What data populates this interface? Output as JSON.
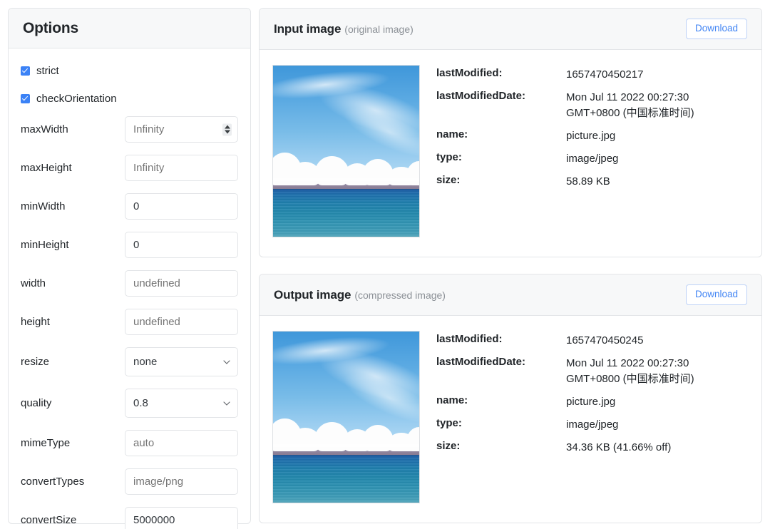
{
  "options": {
    "title": "Options",
    "checkboxes": [
      {
        "name": "strict",
        "label": "strict",
        "checked": true
      },
      {
        "name": "checkOrientation",
        "label": "checkOrientation",
        "checked": true
      }
    ],
    "fields": [
      {
        "label": "maxWidth",
        "control": "number",
        "value": "",
        "placeholder": "Infinity"
      },
      {
        "label": "maxHeight",
        "control": "text",
        "value": "",
        "placeholder": "Infinity"
      },
      {
        "label": "minWidth",
        "control": "text",
        "value": "0",
        "placeholder": ""
      },
      {
        "label": "minHeight",
        "control": "text",
        "value": "0",
        "placeholder": ""
      },
      {
        "label": "width",
        "control": "text",
        "value": "",
        "placeholder": "undefined"
      },
      {
        "label": "height",
        "control": "text",
        "value": "",
        "placeholder": "undefined"
      },
      {
        "label": "resize",
        "control": "select",
        "value": "none",
        "placeholder": ""
      },
      {
        "label": "quality",
        "control": "select",
        "value": "0.8",
        "placeholder": ""
      },
      {
        "label": "mimeType",
        "control": "text",
        "value": "",
        "placeholder": "auto"
      },
      {
        "label": "convertTypes",
        "control": "text",
        "value": "",
        "placeholder": "image/png"
      },
      {
        "label": "convertSize",
        "control": "text",
        "value": "5000000",
        "placeholder": ""
      }
    ]
  },
  "cards": [
    {
      "title": "Input image",
      "subtitle": "(original image)",
      "download_label": "Download",
      "image_alt": "lake-and-mountains-photo",
      "meta": [
        {
          "key": "lastModified:",
          "value": "1657470450217"
        },
        {
          "key": "lastModifiedDate:",
          "value": "Mon Jul 11 2022 00:27:30\nGMT+0800 (中国标准时间)"
        },
        {
          "key": "name:",
          "value": "picture.jpg"
        },
        {
          "key": "type:",
          "value": "image/jpeg"
        },
        {
          "key": "size:",
          "value": "58.89 KB"
        }
      ]
    },
    {
      "title": "Output image",
      "subtitle": "(compressed image)",
      "download_label": "Download",
      "image_alt": "lake-and-mountains-photo",
      "meta": [
        {
          "key": "lastModified:",
          "value": "1657470450245"
        },
        {
          "key": "lastModifiedDate:",
          "value": "Mon Jul 11 2022 00:27:30\nGMT+0800 (中国标准时间)"
        },
        {
          "key": "name:",
          "value": "picture.jpg"
        },
        {
          "key": "type:",
          "value": "image/jpeg"
        },
        {
          "key": "size:",
          "value": "34.36 KB (41.66% off)"
        }
      ]
    }
  ],
  "colors": {
    "accent": "#4285f4",
    "checkbox": "#3b82f6",
    "header_bg": "#f7f8f9",
    "border": "#e3e5e8",
    "muted_text": "#8b9096",
    "placeholder_text": "#9aa0a6"
  }
}
